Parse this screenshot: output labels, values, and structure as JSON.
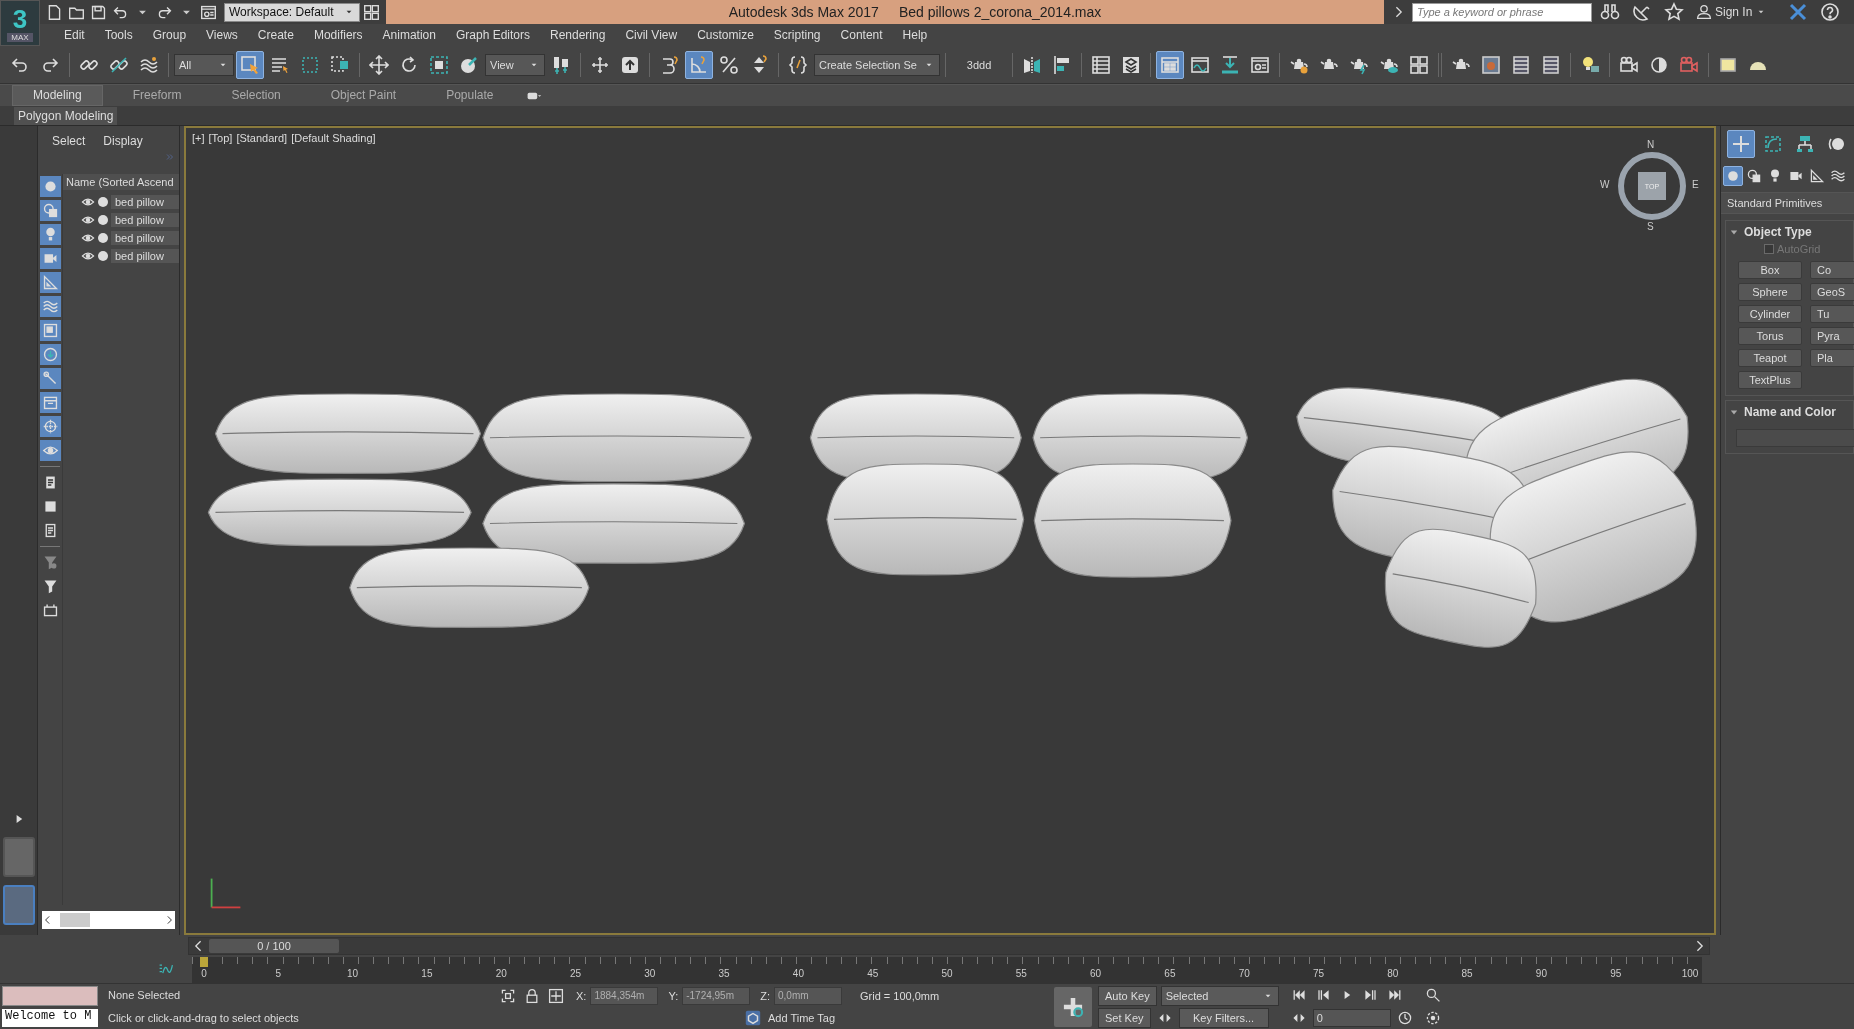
{
  "title_bar": {
    "logo": "3",
    "logo_label": "MAX",
    "workspace": "Workspace: Default",
    "app_title": "Autodesk 3ds Max 2017",
    "file_name": "Bed pillows 2_corona_2014.max",
    "search": {
      "placeholder": "Type a keyword or phrase"
    },
    "sign_in": "Sign In"
  },
  "menu": [
    "Edit",
    "Tools",
    "Group",
    "Views",
    "Create",
    "Modifiers",
    "Animation",
    "Graph Editors",
    "Rendering",
    "Civil View",
    "Customize",
    "Scripting",
    "Content",
    "Help"
  ],
  "toolbar": {
    "groups": [
      [
        {
          "kind": "button",
          "selected": false
        },
        {
          "kind": "button",
          "selected": false
        }
      ],
      [
        {
          "kind": "button",
          "selected": false
        },
        {
          "kind": "button",
          "selected": false
        },
        {
          "kind": "button",
          "selected": false
        }
      ],
      [
        {
          "kind": "dropdown",
          "value": "All"
        },
        {
          "kind": "button",
          "selected": true
        },
        {
          "kind": "button",
          "selected": false
        },
        {
          "kind": "button",
          "selected": false
        },
        {
          "kind": "button",
          "selected": false
        }
      ],
      [
        {
          "kind": "button",
          "selected": false
        },
        {
          "kind": "button",
          "selected": false
        },
        {
          "kind": "button",
          "selected": false
        },
        {
          "kind": "button",
          "selected": false
        },
        {
          "kind": "dropdown",
          "value": "View"
        },
        {
          "kind": "button",
          "selected": false
        }
      ],
      [
        {
          "kind": "button",
          "selected": false
        },
        {
          "kind": "button",
          "selected": false
        }
      ],
      [
        {
          "kind": "button",
          "selected": false
        },
        {
          "kind": "button",
          "selected": true
        },
        {
          "kind": "button",
          "selected": false
        },
        {
          "kind": "button",
          "selected": false
        }
      ],
      [
        {
          "kind": "button",
          "selected": false
        },
        {
          "kind": "dropdown",
          "value": "Create Selection Se"
        }
      ],
      [
        {
          "kind": "label",
          "text": "3ddd"
        }
      ],
      [
        {
          "kind": "button",
          "selected": false
        },
        {
          "kind": "button",
          "selected": false
        }
      ],
      [
        {
          "kind": "button",
          "selected": false
        },
        {
          "kind": "button",
          "selected": false
        }
      ],
      [
        {
          "kind": "button",
          "selected": true
        },
        {
          "kind": "button",
          "selected": false
        },
        {
          "kind": "button",
          "selected": false
        },
        {
          "kind": "button",
          "selected": false
        }
      ],
      [
        {
          "kind": "button",
          "selected": false
        },
        {
          "kind": "button",
          "selected": false
        },
        {
          "kind": "button",
          "selected": false
        },
        {
          "kind": "button",
          "selected": false
        },
        {
          "kind": "button",
          "selected": false
        }
      ],
      [
        {
          "kind": "button",
          "selected": false
        },
        {
          "kind": "button",
          "selected": false
        },
        {
          "kind": "button",
          "selected": false
        },
        {
          "kind": "button",
          "selected": false
        }
      ],
      [
        {
          "kind": "button",
          "selected": false
        }
      ],
      [
        {
          "kind": "button",
          "selected": false
        },
        {
          "kind": "button",
          "selected": false
        },
        {
          "kind": "button",
          "selected": false
        }
      ],
      [
        {
          "kind": "button",
          "selected": false
        },
        {
          "kind": "button",
          "selected": false
        }
      ]
    ]
  },
  "ribbon": {
    "tabs": [
      {
        "label": "Modeling",
        "selected": true
      },
      {
        "label": "Freeform",
        "selected": false
      },
      {
        "label": "Selection",
        "selected": false
      },
      {
        "label": "Object Paint",
        "selected": false
      },
      {
        "label": "Populate",
        "selected": false
      }
    ],
    "panel_label": "Polygon Modeling"
  },
  "layout_tabs": [
    {
      "selected": false
    },
    {
      "selected": true
    }
  ],
  "scene_explorer": {
    "tabs": [
      "Select",
      "Display"
    ],
    "filters": [
      {
        "selected": true
      },
      {
        "selected": true
      },
      {
        "selected": true
      },
      {
        "selected": true
      },
      {
        "selected": true
      },
      {
        "selected": true
      },
      {
        "selected": true
      },
      {
        "selected": true
      },
      {
        "selected": true
      },
      {
        "selected": true
      },
      {
        "selected": true
      },
      {
        "selected": true
      },
      {
        "selected": false
      },
      {
        "selected": false
      },
      {
        "selected": false
      },
      {
        "selected": false
      },
      {
        "selected": false
      },
      {
        "selected": false
      }
    ],
    "column": "Name (Sorted Ascend",
    "rows": [
      {
        "name": "bed pillow",
        "visible": true
      },
      {
        "name": "bed pillow",
        "visible": true
      },
      {
        "name": "bed pillow",
        "visible": true
      },
      {
        "name": "bed pillow",
        "visible": true
      }
    ]
  },
  "viewport": {
    "labels": [
      "[+]",
      "[Top]",
      "[Standard]",
      "[Default Shading]"
    ],
    "active": true,
    "viewcube": {
      "face": "TOP",
      "north": "N",
      "south": "S",
      "east": "E",
      "west": "W"
    }
  },
  "command_panel": {
    "tabs": [
      {
        "selected": true
      },
      {
        "selected": false
      },
      {
        "selected": false
      },
      {
        "selected": false
      }
    ],
    "categories": [
      {
        "selected": true
      },
      {
        "selected": false
      },
      {
        "selected": false
      },
      {
        "selected": false
      },
      {
        "selected": false
      },
      {
        "selected": false
      }
    ],
    "dropdown": "Standard Primitives",
    "object_type": {
      "title": "Object Type",
      "expanded": true,
      "autogrid": {
        "label": "AutoGrid",
        "checked": false,
        "disabled": true
      },
      "buttons": [
        "Box",
        "Co",
        "Sphere",
        "GeoS",
        "Cylinder",
        "Tu",
        "Torus",
        "Pyra",
        "Teapot",
        "Pla",
        "TextPlus"
      ]
    },
    "name_and_color": {
      "title": "Name and Color",
      "expanded": true
    }
  },
  "time_slider": {
    "position": "0 / 100",
    "level": 0
  },
  "track_bar": {
    "ticks": [
      "0",
      "5",
      "10",
      "15",
      "20",
      "25",
      "30",
      "35",
      "40",
      "45",
      "50",
      "55",
      "60",
      "65",
      "70",
      "75",
      "80",
      "85",
      "90",
      "95",
      "100"
    ]
  },
  "status": {
    "listener_output": "Welcome to M",
    "selection": "None Selected",
    "prompt": "Click or click-and-drag to select objects",
    "coords": [
      {
        "axis": "X:",
        "value": "1884,354m"
      },
      {
        "axis": "Y:",
        "value": "-1724,95m"
      },
      {
        "axis": "Z:",
        "value": "0,0mm"
      }
    ],
    "grid": "Grid = 100,0mm",
    "time_tag": "Add Time Tag",
    "auto_key": "Auto Key",
    "key_mode": "Selected",
    "set_key": "Set Key",
    "key_filters": "Key Filters...",
    "frame": "0"
  }
}
